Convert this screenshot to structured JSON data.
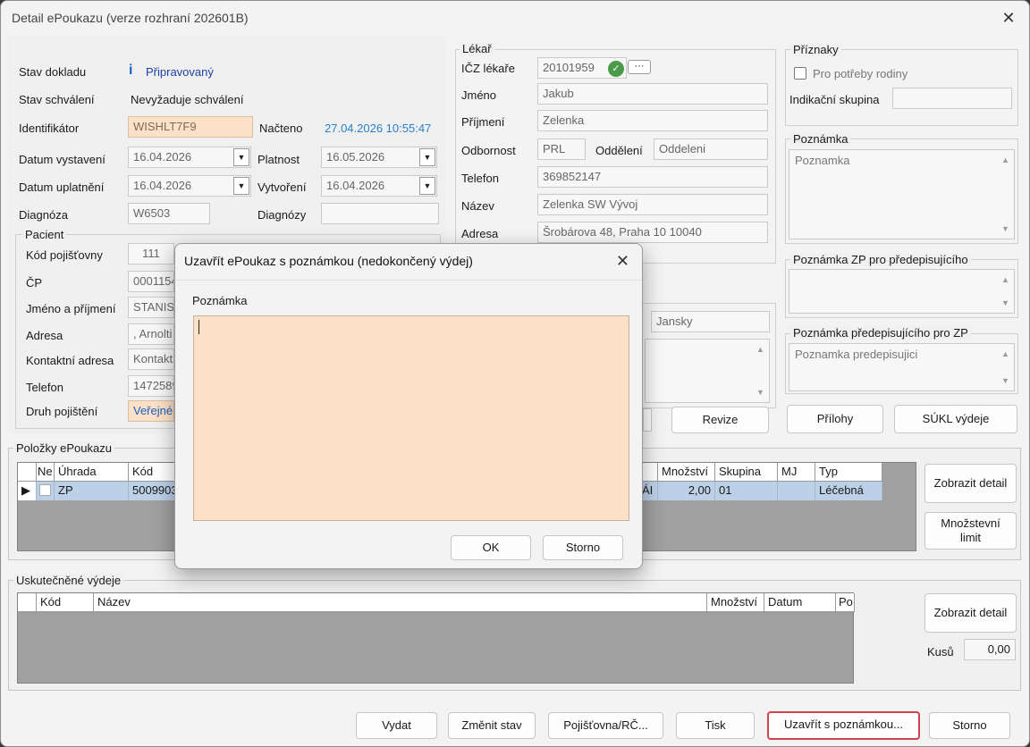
{
  "window": {
    "title": "Detail ePoukazu (verze rozhraní 202601B)"
  },
  "doc": {
    "stav_dokladu_label": "Stav dokladu",
    "stav_dokladu_icon": "info-icon",
    "stav_dokladu": "Připravovaný",
    "stav_schvaleni_label": "Stav schválení",
    "stav_schvaleni": "Nevyžaduje schválení",
    "identifikator_label": "Identifikátor",
    "identifikator": "WISHLT7F9",
    "nacteno_label": "Načteno",
    "nacteno": "27.04.2026 10:55:47",
    "datum_vystaveni_label": "Datum vystavení",
    "datum_vystaveni": "16.04.2026",
    "platnost_label": "Platnost",
    "platnost": "16.05.2026",
    "datum_uplatneni_label": "Datum uplatnění",
    "datum_uplatneni": "16.04.2026",
    "vytvoreni_label": "Vytvoření",
    "vytvoreni": "16.04.2026",
    "diagnoza_label": "Diagnóza",
    "diagnoza": "W6503",
    "diagnozy_label": "Diagnózy",
    "diagnozy": ""
  },
  "pacient": {
    "title": "Pacient",
    "kod_pojistovny_label": "Kód pojišťovny",
    "kod_pojistovny": "111",
    "cp_label": "ČP",
    "cp": "0001154",
    "jmeno_label": "Jméno a příjmení",
    "jmeno": "STANISL",
    "adresa_label": "Adresa",
    "adresa": ", Arnolti",
    "kontaktni_label": "Kontaktní adresa",
    "kontaktni": "Kontakt",
    "telefon_label": "Telefon",
    "telefon": "1472589",
    "druh_label": "Druh pojištění",
    "druh": "Veřejné"
  },
  "lekar": {
    "title": "Lékař",
    "icz_label": "IČZ lékaře",
    "icz": "20101959",
    "more_label": "···",
    "jmeno_label": "Jméno",
    "jmeno": "Jakub",
    "prijmeni_label": "Příjmení",
    "prijmeni": "Zelenka",
    "odbornost_label": "Odbornost",
    "odbornost": "PRL",
    "oddeleni_label": "Oddělení",
    "oddeleni": "Oddeleni",
    "telefon_label": "Telefon",
    "telefon": "369852147",
    "nazev_label": "Název",
    "nazev": "Zelenka SW Vývoj",
    "adresa_label": "Adresa",
    "adresa": "Šrobárova  48, Praha 10 10040",
    "extra_field": "Jansky",
    "revize_button": "Revize"
  },
  "priznaky": {
    "title": "Příznaky",
    "pro_potreby_rodiny": "Pro potřeby rodiny",
    "indikacni_label": "Indikační skupina",
    "indikacni": ""
  },
  "poznamka": {
    "title": "Poznámka",
    "value": "Poznamka"
  },
  "poznamka_zp": {
    "title": "Poznámka ZP pro předepisujícího",
    "value": ""
  },
  "poznamka_pred": {
    "title": "Poznámka předepisujícího pro ZP",
    "value": "Poznamka predepisujici"
  },
  "side_buttons": {
    "prilohy": "Přílohy",
    "sukl": "SÚKL výdeje"
  },
  "polozky": {
    "title": "Položky ePoukazu",
    "headers": [
      "Ne",
      "Úhrada",
      "Kód",
      "Množství",
      "Skupina",
      "MJ",
      "Typ"
    ],
    "row": {
      "uhrada": "ZP",
      "kod": "5009903",
      "partial": "FÁI",
      "mnozstvi": "2,00",
      "skupina": "01",
      "mj": "",
      "typ": "Léčebná"
    },
    "detail_button": "Zobrazit detail",
    "limit_button_1": "Množstevní",
    "limit_button_2": "limit"
  },
  "vydeje": {
    "title": "Uskutečněné výdeje",
    "headers": [
      "Kód",
      "Název",
      "Množství",
      "Datum",
      "Po"
    ],
    "detail_button": "Zobrazit detail",
    "kusu_label": "Kusů",
    "kusu": "0,00"
  },
  "bottom": {
    "vydat": "Vydat",
    "zmenit_stav": "Změnit stav",
    "pojistovna": "Pojišťovna/RČ...",
    "tisk": "Tisk",
    "uzavrit": "Uzavřít s poznámkou...",
    "storno": "Storno"
  },
  "dialog": {
    "title": "Uzavřít ePoukaz s poznámkou (nedokončený výdej)",
    "poznamka_label": "Poznámka",
    "poznamka_value": "",
    "ok": "OK",
    "storno": "Storno"
  }
}
